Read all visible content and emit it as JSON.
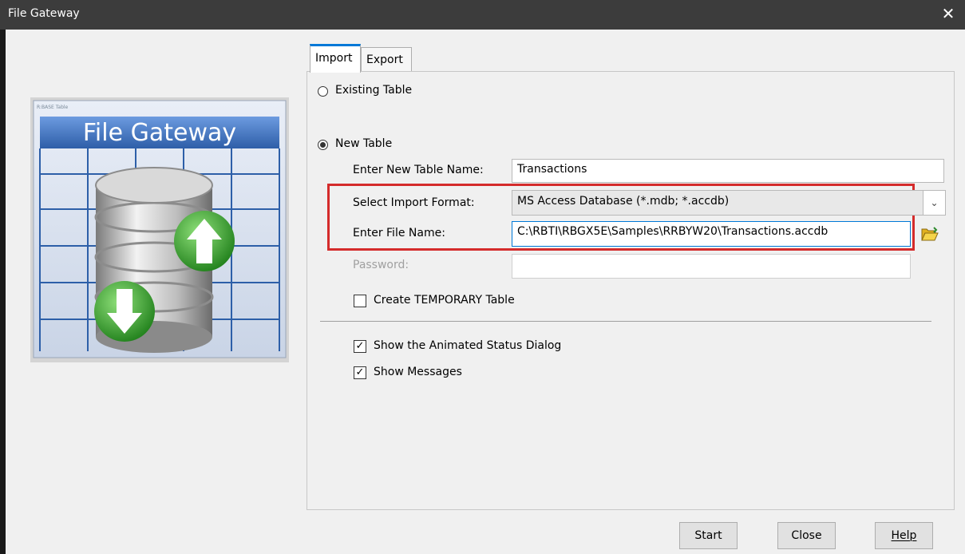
{
  "window": {
    "title": "File Gateway",
    "close_glyph": "✕"
  },
  "logo": {
    "small_caption": "R:BASE Table",
    "title": "File Gateway",
    "icon": "database-import-export-icon"
  },
  "tabs": [
    {
      "label": "Import"
    },
    {
      "label": "Export"
    }
  ],
  "import": {
    "existing_table_label": "Existing Table",
    "new_table_label": "New Table",
    "new_table_name_label": "Enter New Table Name:",
    "new_table_name_value": "Transactions",
    "format_label": "Select Import Format:",
    "format_value": "MS Access Database (*.mdb; *.accdb)",
    "file_name_label": "Enter File Name:",
    "file_name_value": "C:\\RBTI\\RBGX5E\\Samples\\RRBYW20\\Transactions.accdb",
    "password_label": "Password:",
    "password_value": "",
    "temporary_label": "Create TEMPORARY Table",
    "temporary_checked": false,
    "status_dialog_label": "Show the Animated Status Dialog",
    "status_dialog_checked": true,
    "messages_label": "Show Messages",
    "messages_checked": true
  },
  "buttons": {
    "start": "Start",
    "close": "Close",
    "help": "Help"
  },
  "colors": {
    "highlight": "#d42b2b",
    "accent": "#0078d7",
    "banner": "#3d6fb6"
  }
}
